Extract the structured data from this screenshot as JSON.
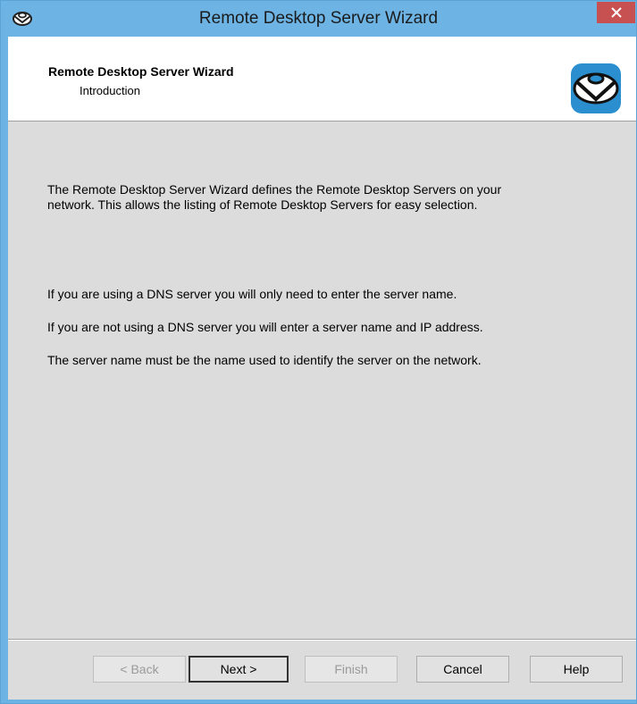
{
  "window": {
    "title": "Remote Desktop Server Wizard",
    "close_glyph": "×",
    "accent": "#6db3e4",
    "close_color": "#c75050"
  },
  "header": {
    "title": "Remote Desktop Server Wizard",
    "subtitle": "Introduction",
    "logo_icon": "terminal-server-logo-icon"
  },
  "content": {
    "paragraph1_line1": "The Remote Desktop Server Wizard defines the Remote Desktop Servers on your",
    "paragraph1_line2": "network. This allows the listing of Remote Desktop Servers for easy selection.",
    "line_dns": "If you are using a DNS server you will only need to enter the server name.",
    "line_no_dns": "If you are not using a DNS server you will enter a server name and IP address.",
    "line_server_name": "The server name must be the name used to identify the server on the network."
  },
  "buttons": {
    "back": "< Back",
    "next": "Next >",
    "finish": "Finish",
    "cancel": "Cancel",
    "help": "Help"
  }
}
